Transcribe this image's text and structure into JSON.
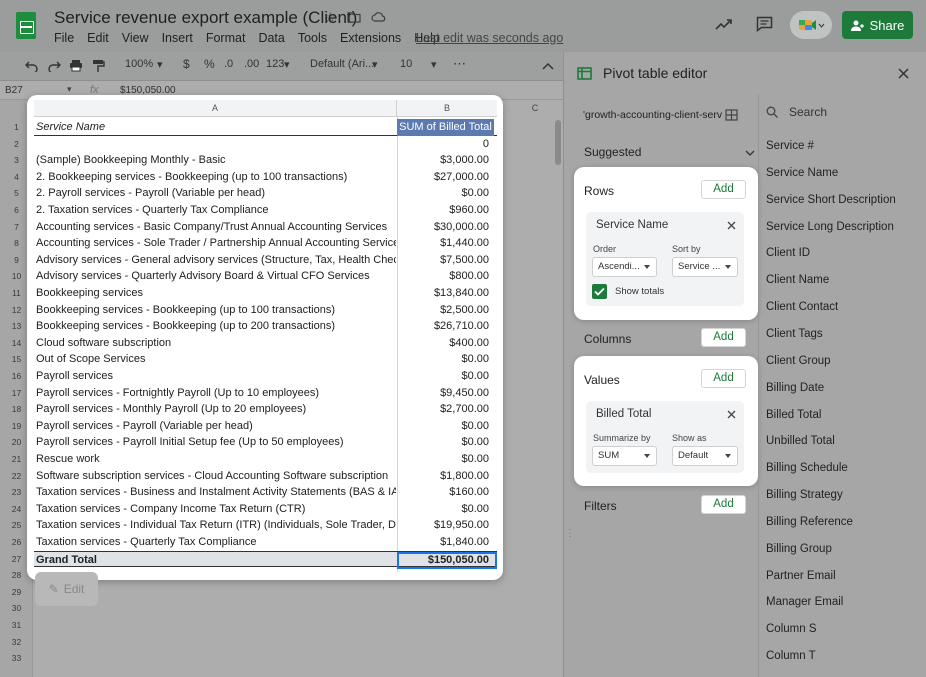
{
  "app": {
    "title": "Service revenue export example (Client)",
    "menu": [
      "File",
      "Edit",
      "View",
      "Insert",
      "Format",
      "Data",
      "Tools",
      "Extensions",
      "Help"
    ],
    "last_edit": "Last edit was seconds ago",
    "share_label": "Share"
  },
  "toolbar": {
    "zoom": "100%",
    "currency": "$",
    "percent": "%",
    "dec_decrease": ".0",
    "dec_increase": ".00",
    "number_format": "123",
    "font": "Default (Ari...",
    "font_size": "10",
    "more": "⋯"
  },
  "formula_bar": {
    "cell_ref": "B27",
    "fx": "fx",
    "value": "$150,050.00"
  },
  "sheet": {
    "col_a": "A",
    "col_b": "B",
    "col_c": "C",
    "header_a": "Service Name",
    "header_b": "SUM of Billed Total",
    "rows": [
      {
        "a": "",
        "b": "0"
      },
      {
        "a": "(Sample) Bookkeeping Monthly - Basic",
        "b": "$3,000.00"
      },
      {
        "a": "2. Bookkeeping services - Bookkeeping (up to 100 transactions)",
        "b": "$27,000.00"
      },
      {
        "a": "2. Payroll services - Payroll (Variable per head)",
        "b": "$0.00"
      },
      {
        "a": "2. Taxation services - Quarterly Tax Compliance",
        "b": "$960.00"
      },
      {
        "a": "Accounting services - Basic Company/Trust Annual Accounting Services",
        "b": "$30,000.00"
      },
      {
        "a": "Accounting services - Sole Trader / Partnership Annual Accounting Services &",
        "b": "$1,440.00"
      },
      {
        "a": "Advisory services - General advisory services (Structure, Tax, Health Check, c",
        "b": "$7,500.00"
      },
      {
        "a": "Advisory services - Quarterly Advisory Board & Virtual CFO Services",
        "b": "$800.00"
      },
      {
        "a": "Bookkeeping services",
        "b": "$13,840.00"
      },
      {
        "a": "Bookkeeping services - Bookkeeping (up to 100 transactions)",
        "b": "$2,500.00"
      },
      {
        "a": "Bookkeeping services - Bookkeeping (up to 200 transactions)",
        "b": "$26,710.00"
      },
      {
        "a": "Cloud software subscription",
        "b": "$400.00"
      },
      {
        "a": "Out of Scope Services",
        "b": "$0.00"
      },
      {
        "a": "Payroll services",
        "b": "$0.00"
      },
      {
        "a": "Payroll services - Fortnightly Payroll (Up to 10 employees)",
        "b": "$9,450.00"
      },
      {
        "a": "Payroll services - Monthly Payroll (Up to 20 employees)",
        "b": "$2,700.00"
      },
      {
        "a": "Payroll services - Payroll (Variable per head)",
        "b": "$0.00"
      },
      {
        "a": "Payroll services - Payroll Initial Setup fee (Up to 50 employees)",
        "b": "$0.00"
      },
      {
        "a": "Rescue work",
        "b": "$0.00"
      },
      {
        "a": "Software subscription services - Cloud Accounting Software subscription",
        "b": "$1,800.00"
      },
      {
        "a": "Taxation services - Business and Instalment Activity Statements (BAS & IAS)",
        "b": "$160.00"
      },
      {
        "a": "Taxation services - Company Income Tax Return (CTR)",
        "b": "$0.00"
      },
      {
        "a": "Taxation services - Individual Tax Return (ITR) (Individuals, Sole Trader, Direc",
        "b": "$19,950.00"
      },
      {
        "a": "Taxation services - Quarterly Tax Compliance",
        "b": "$1,840.00"
      }
    ],
    "grand_total_label": "Grand Total",
    "grand_total_value": "$150,050.00",
    "row_numbers": [
      "1",
      "2",
      "3",
      "4",
      "5",
      "6",
      "7",
      "8",
      "9",
      "10",
      "11",
      "12",
      "13",
      "14",
      "15",
      "16",
      "17",
      "18",
      "19",
      "20",
      "21",
      "22",
      "23",
      "24",
      "25",
      "26",
      "27",
      "28",
      "29",
      "30",
      "31",
      "32",
      "33"
    ],
    "edit_label": "Edit"
  },
  "pivot_editor": {
    "title": "Pivot table editor",
    "range": "'growth-accounting-client-serv",
    "suggested": "Suggested",
    "rows_label": "Rows",
    "add_label": "Add",
    "row_field": "Service Name",
    "order_label": "Order",
    "order_value": "Ascendi...",
    "sortby_label": "Sort by",
    "sortby_value": "Service ...",
    "show_totals": "Show totals",
    "columns_label": "Columns",
    "values_label": "Values",
    "value_field": "Billed Total",
    "summarize_label": "Summarize by",
    "summarize_value": "SUM",
    "showas_label": "Show as",
    "showas_value": "Default",
    "filters_label": "Filters",
    "search_placeholder": "Search",
    "fields": [
      "Service #",
      "Service Name",
      "Service Short Description",
      "Service Long Description",
      "Client ID",
      "Client Name",
      "Client Contact",
      "Client Tags",
      "Client Group",
      "Billing Date",
      "Billed Total",
      "Unbilled Total",
      "Billing Schedule",
      "Billing Strategy",
      "Billing Reference",
      "Billing Group",
      "Partner Email",
      "Manager Email",
      "Column S",
      "Column T"
    ]
  }
}
